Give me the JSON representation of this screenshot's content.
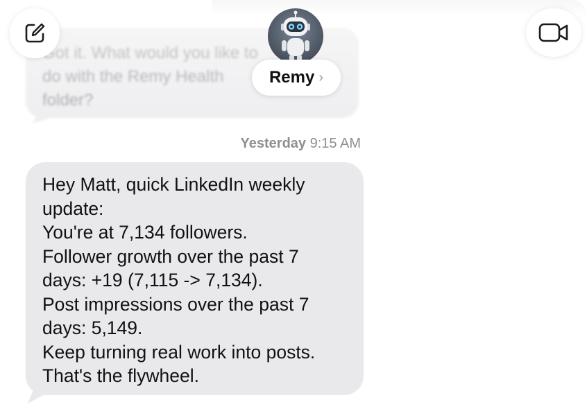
{
  "contact": {
    "name": "Remy",
    "chevron": "›"
  },
  "header": {
    "compose_icon": "compose-icon",
    "video_icon": "video-call-icon"
  },
  "previous_message": {
    "lines": [
      "Got it. What would you like to",
      "do with the Remy Health",
      "folder?"
    ]
  },
  "timestamp": {
    "day": "Yesterday",
    "time": "9:15 AM"
  },
  "message": {
    "lines": [
      "Hey Matt, quick LinkedIn weekly",
      "update:",
      "You're at 7,134 followers.",
      "Follower growth over the past 7",
      "days: +19 (7,115 -> 7,134).",
      "Post impressions over the past 7",
      "days: 5,149.",
      "Keep turning real work into posts.",
      "That's the flywheel."
    ]
  }
}
